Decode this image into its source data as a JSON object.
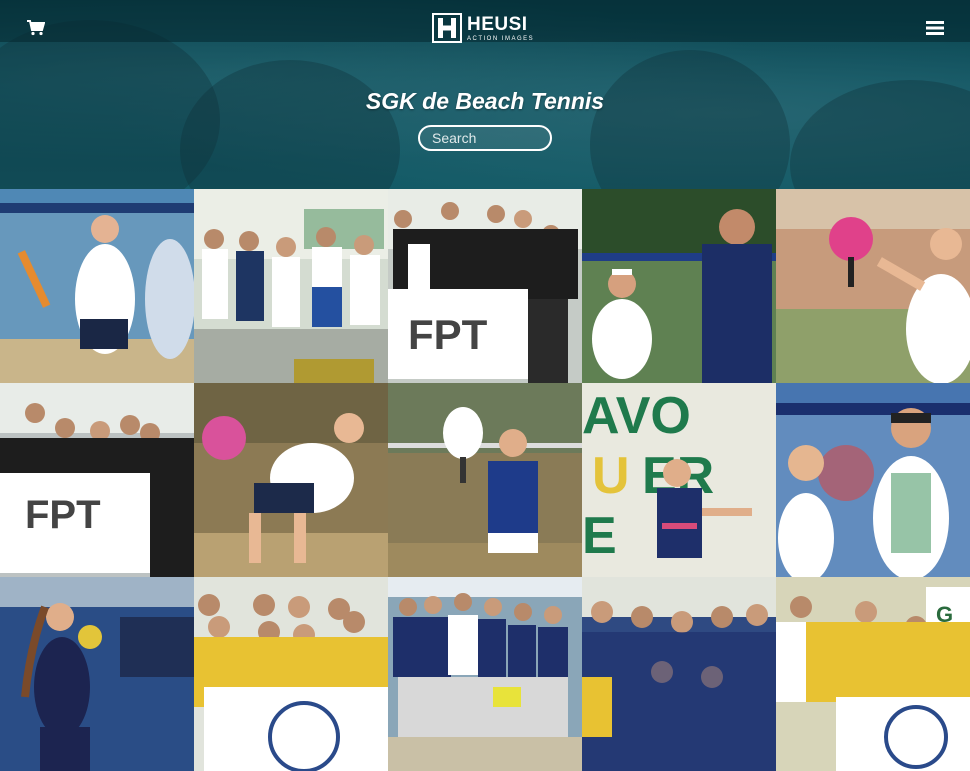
{
  "header": {
    "brand_name": "HEUSI",
    "brand_tagline": "ACTION IMAGES",
    "cart_icon": "shopping-cart-icon",
    "menu_icon": "hamburger-menu-icon"
  },
  "gallery": {
    "title": "SGK de Beach Tennis",
    "search_placeholder": "Search"
  },
  "colors": {
    "hero_teal": "#136070",
    "text": "#ffffff"
  },
  "photos": [
    {
      "subject": "player-with-racket",
      "tone": "#3f7fb0"
    },
    {
      "subject": "team-group-podium",
      "tone": "#c9d3c6"
    },
    {
      "subject": "team-group-banner-fpt",
      "tone": "#b9c2bd"
    },
    {
      "subject": "player-at-net",
      "tone": "#5b7d46"
    },
    {
      "subject": "player-pink-racket",
      "tone": "#c38d73"
    },
    {
      "subject": "group-with-fpt-banner",
      "tone": "#b8bec0"
    },
    {
      "subject": "player-swinging",
      "tone": "#8f7d5a"
    },
    {
      "subject": "player-serving",
      "tone": "#8a7a55"
    },
    {
      "subject": "player-sponsor-wall",
      "tone": "#d9d9cf"
    },
    {
      "subject": "player-sunglasses",
      "tone": "#3f6da8"
    },
    {
      "subject": "young-player-racket",
      "tone": "#2d4f88"
    },
    {
      "subject": "team-yellow-shirts",
      "tone": "#d6b52d"
    },
    {
      "subject": "large-group-photo",
      "tone": "#8aa0ae"
    },
    {
      "subject": "team-navy-medals",
      "tone": "#4a5d88"
    },
    {
      "subject": "team-yellow-banner",
      "tone": "#c7b24a"
    }
  ]
}
